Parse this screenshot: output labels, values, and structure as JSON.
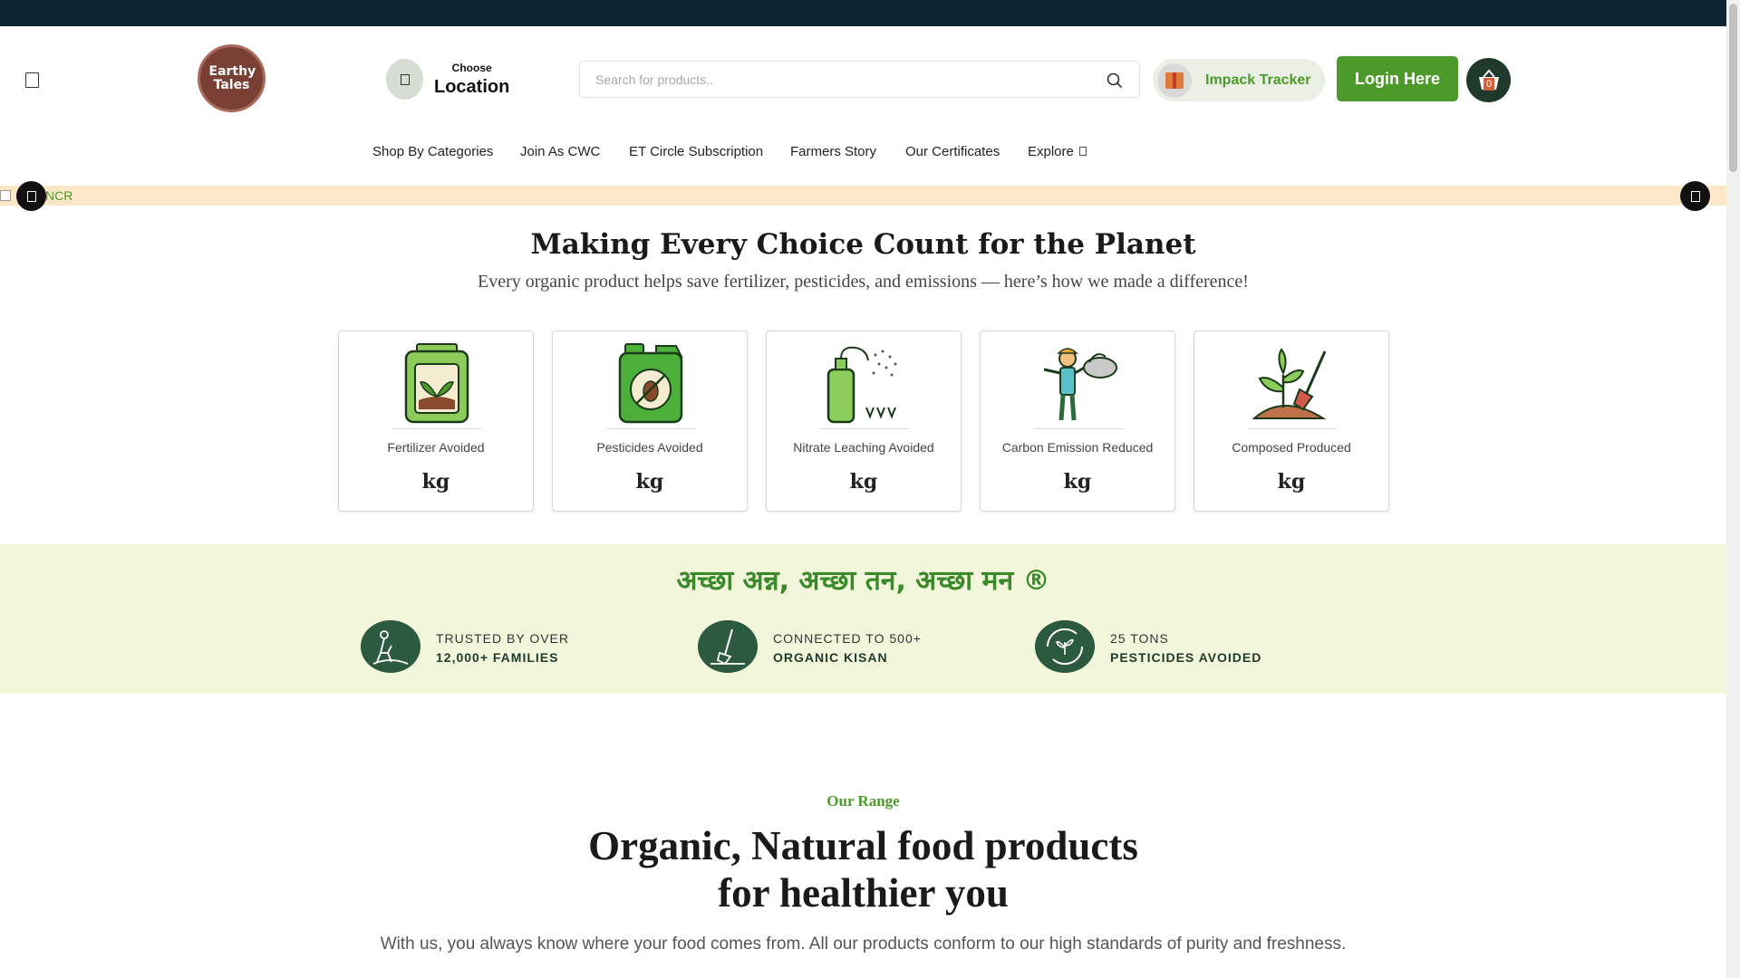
{
  "header": {
    "logo_text": "Earthy Tales",
    "location": {
      "small": "Choose",
      "big": "Location"
    },
    "search_placeholder": "Search for products..",
    "tracker_label": "Impack Tracker",
    "login_label": "Login Here",
    "cart_count": "0"
  },
  "nav": {
    "items": [
      "Shop By Categories",
      "Join As CWC",
      "ET Circle Subscription",
      "Farmers Story",
      "Our Certificates",
      "Explore"
    ]
  },
  "banner": {
    "alt_text": "NCR"
  },
  "impact": {
    "title": "Making Every Choice Count for the Planet",
    "subtitle": "Every organic product helps save fertilizer, pesticides, and emissions — here’s how we made a difference!",
    "cards": [
      {
        "name": "Fertilizer Avoided",
        "unit": "kg",
        "icon": "fertilizer-can-icon"
      },
      {
        "name": "Pesticides Avoided",
        "unit": "kg",
        "icon": "pesticide-can-icon"
      },
      {
        "name": "Nitrate Leaching Avoided",
        "unit": "kg",
        "icon": "spray-bottle-icon"
      },
      {
        "name": "Carbon Emission Reduced",
        "unit": "kg",
        "icon": "farmer-cloud-icon"
      },
      {
        "name": "Composed Produced",
        "unit": "kg",
        "icon": "plant-shovel-icon"
      }
    ]
  },
  "band": {
    "slogan": "अच्छा अन्न, अच्छा तन, अच्छा मन ®",
    "stats": [
      {
        "line1": "TRUSTED BY OVER",
        "line2": "12,000+ FAMILIES",
        "icon": "family-icon"
      },
      {
        "line1": "CONNECTED TO 500+",
        "line2": "ORGANIC KISAN",
        "icon": "shovel-icon"
      },
      {
        "line1": "25 TONS",
        "line2": "PESTICIDES AVOIDED",
        "icon": "recycle-leaf-icon"
      }
    ]
  },
  "range": {
    "eyebrow": "Our Range",
    "title_line1": "Organic, Natural food products",
    "title_line2": "for healthier you",
    "description": "With us, you always know where your food comes from. All our products conform to our high standards of purity and freshness."
  },
  "colors": {
    "brand_green": "#4c9a2a",
    "dark_green": "#1f3a2a",
    "topbar": "#0e2433",
    "band_bg": "#f2f7dc",
    "banner_bg": "#fce8c8"
  }
}
